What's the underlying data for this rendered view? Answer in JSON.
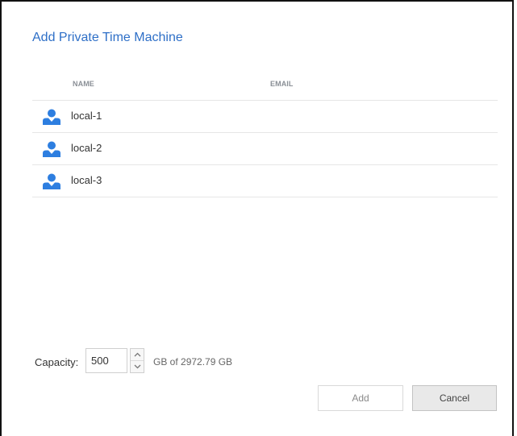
{
  "dialog": {
    "title": "Add Private Time Machine"
  },
  "list": {
    "columns": {
      "name": "NAME",
      "email": "EMAIL"
    },
    "rows": [
      {
        "name": "local-1",
        "email": "",
        "icon": "user-icon"
      },
      {
        "name": "local-2",
        "email": "",
        "icon": "user-icon"
      },
      {
        "name": "local-3",
        "email": "",
        "icon": "user-icon"
      }
    ]
  },
  "capacity": {
    "label": "Capacity:",
    "value": "500",
    "total_text": "GB of 2972.79 GB"
  },
  "buttons": {
    "add_label": "Add",
    "cancel_label": "Cancel"
  },
  "colors": {
    "title": "#2e6fc7",
    "user_icon": "#2d7ee0"
  }
}
